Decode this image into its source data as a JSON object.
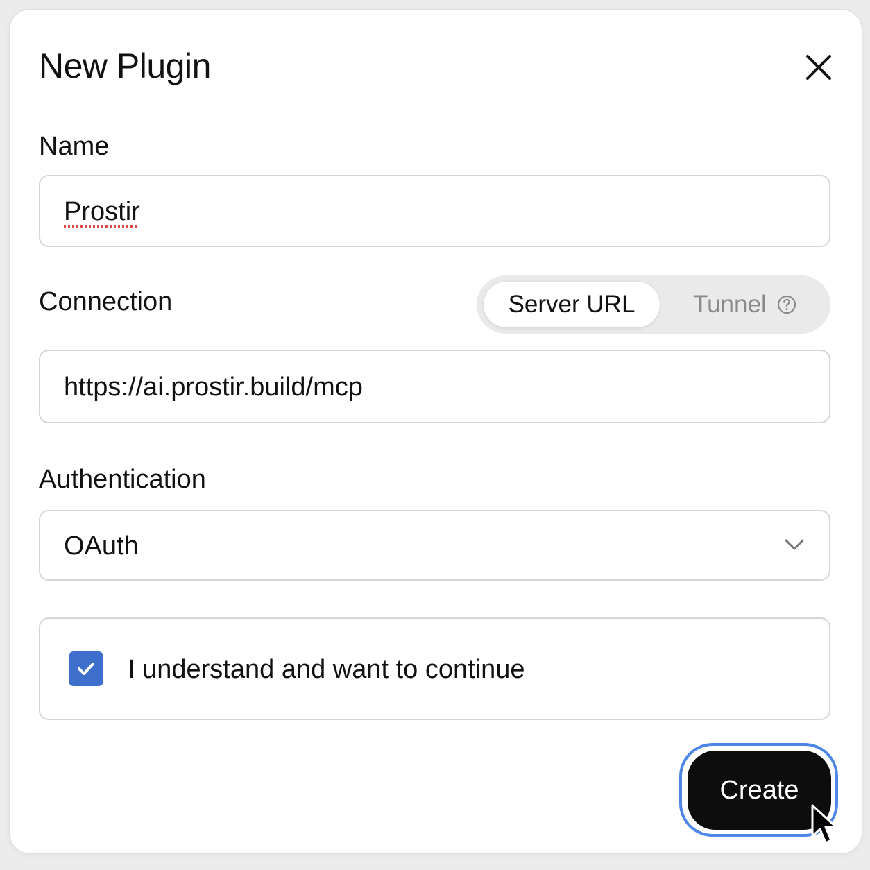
{
  "dialog": {
    "title": "New Plugin",
    "close_icon": "close-icon"
  },
  "name_field": {
    "label": "Name",
    "value": "Prostir"
  },
  "connection": {
    "label": "Connection",
    "options": [
      "Server URL",
      "Tunnel"
    ],
    "selected": "Server URL",
    "help_icon": "help-circle-icon",
    "url_value": "https://ai.prostir.build/mcp"
  },
  "authentication": {
    "label": "Authentication",
    "selected": "OAuth",
    "dropdown_icon": "chevron-down-icon"
  },
  "consent": {
    "checked": true,
    "label": "I understand and want to continue"
  },
  "actions": {
    "create_label": "Create"
  },
  "colors": {
    "accent": "#3f6fcc",
    "focus_ring": "#4d86e6",
    "primary_button": "#0d0d0d"
  }
}
